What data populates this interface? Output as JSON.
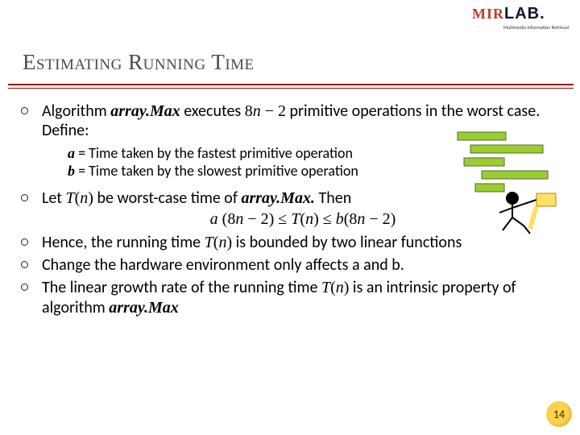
{
  "logo": {
    "mir": "MIR",
    "lab": "LAB.",
    "sub": "Multimedia Information Retrieval"
  },
  "title": "Estimating Running Time",
  "b1": {
    "pre": "Algorithm ",
    "alg": "array.Max",
    "mid": " executes ",
    "expr": "8n − 2",
    "post": " primitive operations in the worst case.  Define:"
  },
  "defs": {
    "a_lhs": "a",
    "a_rhs": " = Time taken by the fastest primitive operation",
    "b_lhs": "b",
    "b_rhs": " = Time taken by the slowest primitive operation"
  },
  "b2": {
    "pre": "Let ",
    "Tn": "T(n)",
    "mid": " be worst-case time of ",
    "alg": "array.Max.",
    "post": " Then",
    "ineq": "a (8n − 2) ≤ T(n) ≤ b(8n − 2)"
  },
  "b3": {
    "pre": "Hence, the running time ",
    "Tn": "T(n)",
    "post": " is bounded by two linear functions"
  },
  "b4": "Change the hardware environment only affects a and b.",
  "b5": {
    "pre": "The linear growth rate of the running time ",
    "Tn": "T(n)",
    "mid": " is an intrinsic property of algorithm ",
    "alg": "array.Max"
  },
  "page_number": "14"
}
